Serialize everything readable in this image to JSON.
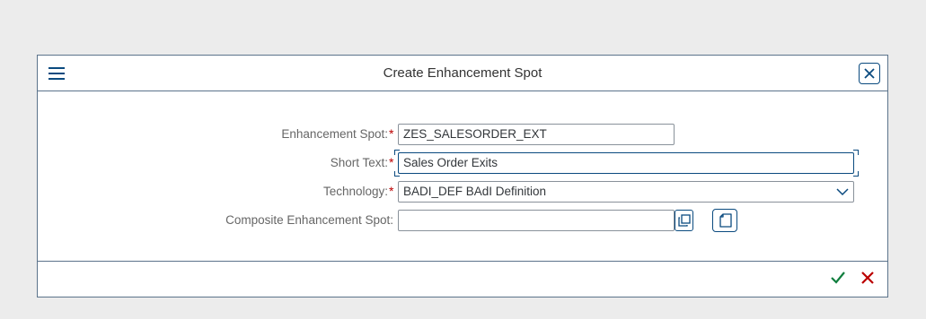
{
  "dialog": {
    "title": "Create Enhancement Spot",
    "menu_icon": "hamburger-menu-icon",
    "close_icon": "close-icon"
  },
  "form": {
    "enhancement_spot": {
      "label": "Enhancement Spot:",
      "required_mark": "*",
      "value": "ZES_SALESORDER_EXT"
    },
    "short_text": {
      "label": "Short Text:",
      "required_mark": "*",
      "value": "Sales Order Exits"
    },
    "technology": {
      "label": "Technology:",
      "required_mark": "*",
      "value": "BADI_DEF BAdI Definition",
      "dropdown_icon": "chevron-down-icon"
    },
    "composite_spot": {
      "label": "Composite Enhancement Spot:",
      "value": "",
      "value_help_icon": "value-help-icon",
      "create_icon": "document-icon"
    }
  },
  "footer": {
    "ok_icon": "checkmark-icon",
    "cancel_icon": "cross-icon"
  },
  "colors": {
    "accent": "#0a4a7f",
    "required": "#bb0000",
    "ok": "#107e3e",
    "cancel": "#bb0000",
    "background": "#ececec"
  }
}
